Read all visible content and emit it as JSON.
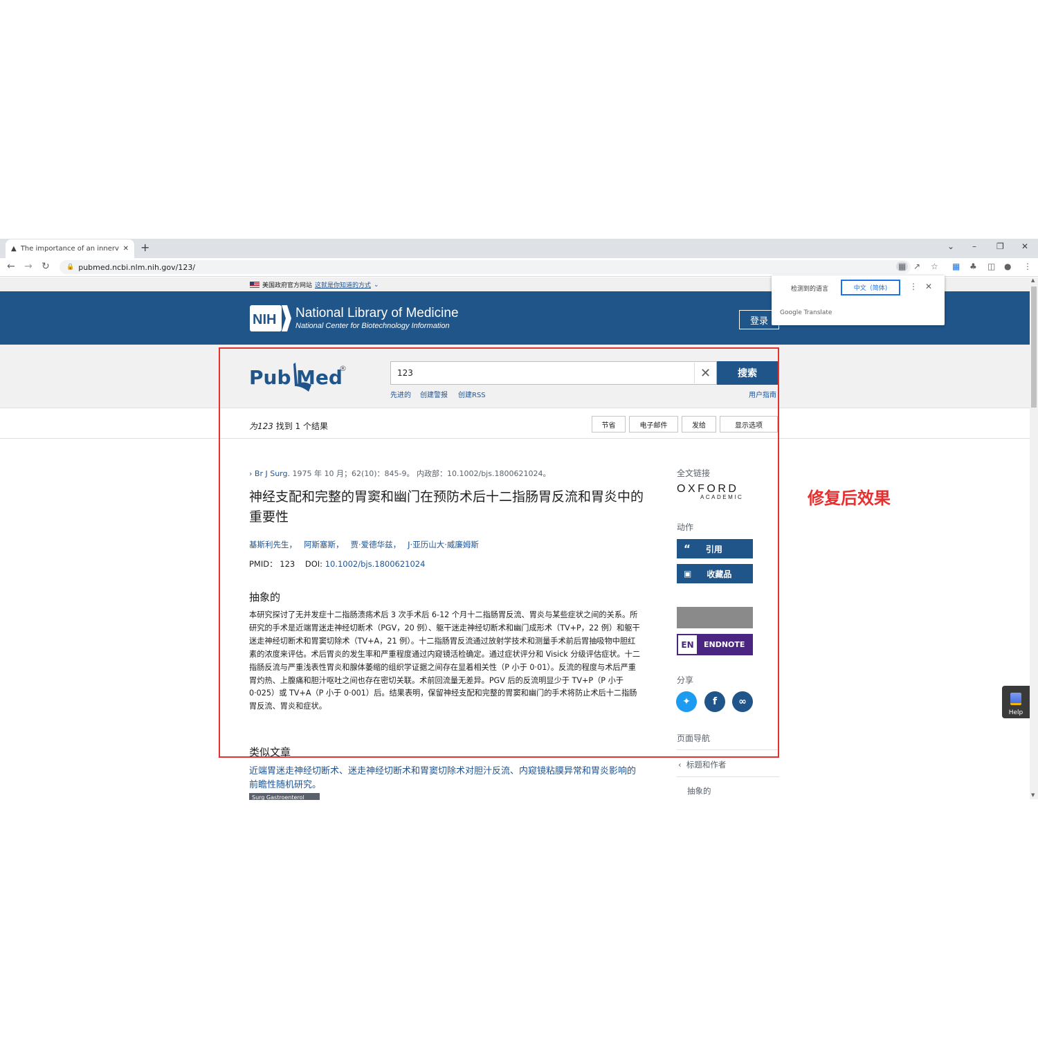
{
  "browser": {
    "tab_title": "The importance of an innervat",
    "url": "pubmed.ncbi.nlm.nih.gov/123/"
  },
  "gov_banner": {
    "text": "美国政府官方网站",
    "link": "这就是你知道的方式"
  },
  "header": {
    "logo_text": "NIH",
    "title": "National Library of Medicine",
    "subtitle": "National Center for Biotechnology Information",
    "login": "登录"
  },
  "translate_popup": {
    "detected": "检测到的语言",
    "target": "中文（简体)",
    "brand": "Google Translate"
  },
  "search": {
    "logo_left": "Pub",
    "logo_right": "Med",
    "logo_mark": "®",
    "query": "123",
    "button": "搜索",
    "links": [
      "先进的",
      "创建警报",
      "创建RSS"
    ],
    "user_guide": "用户指南"
  },
  "results": {
    "count_query": "为123",
    "count_text": " 找到 1 个结果",
    "buttons": [
      "节省",
      "电子邮件",
      "发给",
      "显示选项"
    ]
  },
  "article": {
    "journal": "Br J Surg.",
    "citation": " 1975 年 10 月；62(10)：845-9。 内政部：10.1002/bjs.1800621024。",
    "title": "神经支配和完整的胃窦和幽门在预防术后十二指肠胃反流和胃炎中的重要性",
    "authors": [
      "基斯利先生，",
      "阿斯塞斯，",
      "贾·爱德华兹，",
      "J·亚历山大·威廉姆斯"
    ],
    "pmid_label": "PMID：",
    "pmid": "123",
    "doi_label": "DOI:",
    "doi": "10.1002/bjs.1800621024",
    "abstract_heading": "抽象的",
    "abstract": "本研究探讨了无并发症十二指肠溃疡术后 3 次手术后 6-12 个月十二指肠胃反流、胃炎与某些症状之间的关系。所研究的手术是近端胃迷走神经切断术（PGV，20 例）、躯干迷走神经切断术和幽门成形术（TV+P，22 例）和躯干迷走神经切断术和胃窦切除术（TV+A，21 例）。十二指肠胃反流通过放射学技术和测量手术前后胃抽吸物中胆红素的浓度来评估。术后胃炎的发生率和严重程度通过内窥镜活检确定。通过症状评分和 Visick 分级评估症状。十二指肠反流与严重浅表性胃炎和腺体萎缩的组织学证据之间存在显着相关性（P 小于 0·01）。反流的程度与术后严重胃灼热、上腹痛和胆汁呕吐之间也存在密切关联。术前回流量无差异。PGV 后的反流明显少于 TV+P（P 小于 0·025）或 TV+A（P 小于 0·001）后。结果表明，保留神经支配和完整的胃窦和幽门的手术将防止术后十二指肠胃反流、胃炎和症状。",
    "similar_heading": "类似文章",
    "similar_link": "近端胃迷走神经切断术、迷走神经切断术和胃窦切除术对胆汁反流、内窥镜粘膜异常和胃炎影响的前瞻性随机研究。",
    "similar_journal": "Surg Gastroenterol"
  },
  "sidebar": {
    "fulltext_label": "全文链接",
    "oxford_top": "OXFORD",
    "oxford_bottom": "ACADEMIC",
    "actions_label": "动作",
    "cite": "引用",
    "favorites": "收藏品",
    "endnote_badge": "EN",
    "endnote": "ENDNOTE",
    "share_label": "分享",
    "page_nav_label": "页面导航",
    "nav_items": [
      "标题和作者",
      "抽象的"
    ]
  },
  "help": "Help",
  "annotation": "修复后效果",
  "colors": {
    "nih_blue": "#20558a",
    "endnote_purple": "#4b2582",
    "twitter": "#1d9bf0",
    "facebook": "#20558a",
    "link": "#205493",
    "annotation_red": "#e53030"
  }
}
